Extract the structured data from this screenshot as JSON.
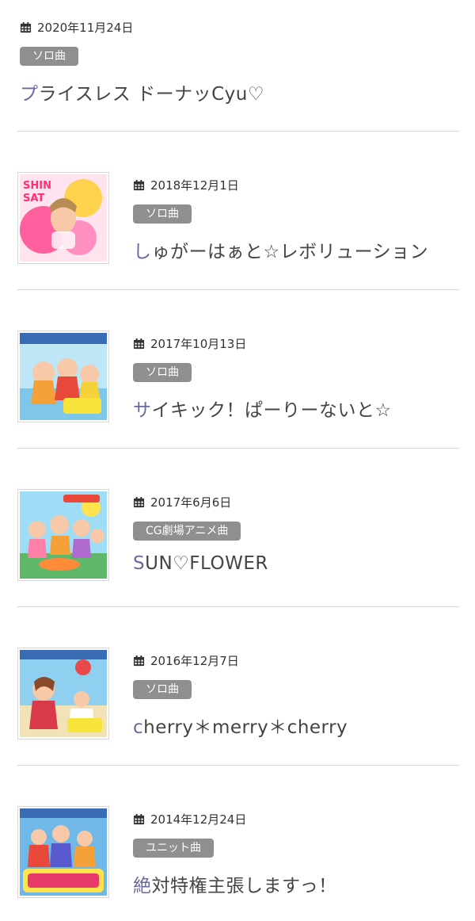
{
  "entries": [
    {
      "date": "2020年11月24日",
      "category": "ソロ曲",
      "title": "プライスレス ドーナッCyu♡",
      "has_thumb": false
    },
    {
      "date": "2018年12月1日",
      "category": "ソロ曲",
      "title": "しゅがーはぁと☆レボリューション",
      "has_thumb": true,
      "thumb_text": "SHIN SAT"
    },
    {
      "date": "2017年10月13日",
      "category": "ソロ曲",
      "title": "サイキック！ぱーりーないと☆",
      "has_thumb": true
    },
    {
      "date": "2017年6月6日",
      "category": "CG劇場アニメ曲",
      "title": "SUN♡FLOWER",
      "has_thumb": true
    },
    {
      "date": "2016年12月7日",
      "category": "ソロ曲",
      "title": "cherry＊merry＊cherry",
      "has_thumb": true
    },
    {
      "date": "2014年12月24日",
      "category": "ユニット曲",
      "title": "絶対特権主張しますっ！",
      "has_thumb": true
    }
  ],
  "colors": {
    "badge": "#8f8f8f",
    "title_first_char": "#6a6a9e",
    "divider": "#d8d8d8"
  }
}
